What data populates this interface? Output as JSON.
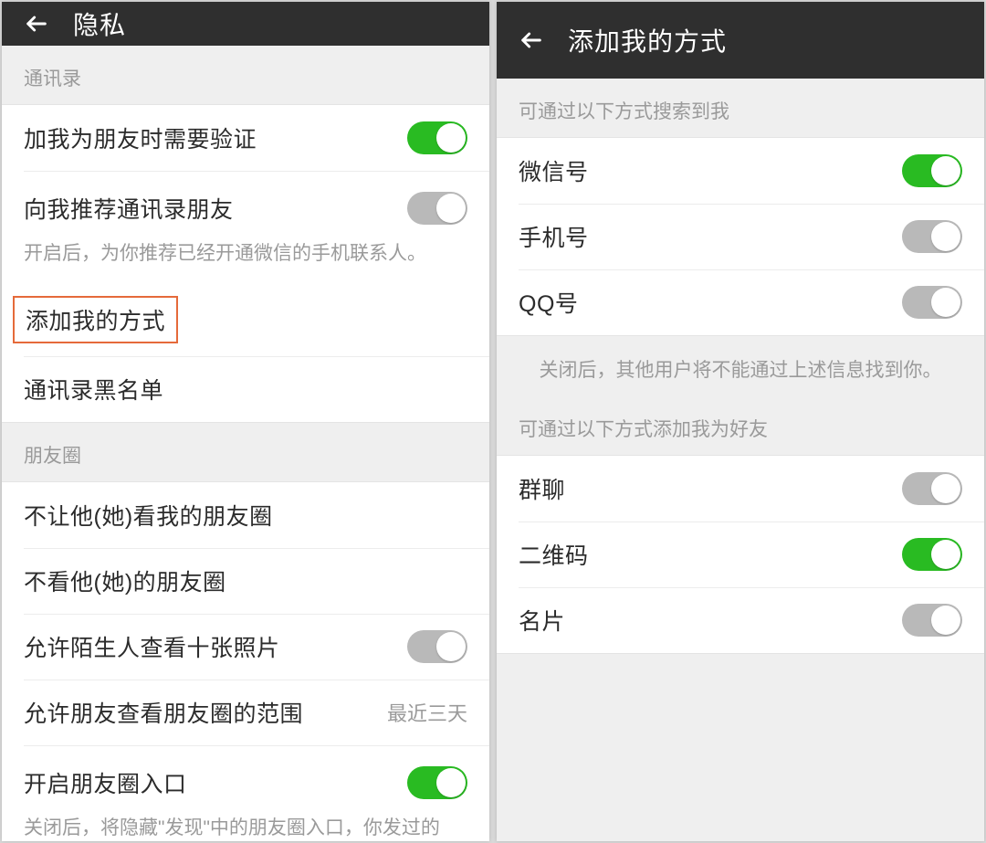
{
  "left": {
    "title": "隐私",
    "sections": {
      "contacts": {
        "header": "通讯录",
        "verify_label": "加我为朋友时需要验证",
        "verify_on": true,
        "recommend_label": "向我推荐通讯录朋友",
        "recommend_on": false,
        "recommend_hint": "开启后，为你推荐已经开通微信的手机联系人。",
        "add_methods_label": "添加我的方式",
        "blacklist_label": "通讯录黑名单"
      },
      "moments": {
        "header": "朋友圈",
        "hide_my_label": "不让他(她)看我的朋友圈",
        "hide_their_label": "不看他(她)的朋友圈",
        "stranger_label": "允许陌生人查看十张照片",
        "stranger_on": false,
        "range_label": "允许朋友查看朋友圈的范围",
        "range_value": "最近三天",
        "entry_label": "开启朋友圈入口",
        "entry_on": true,
        "entry_hint": "关闭后，将隐藏\"发现\"中的朋友圈入口，你发过的"
      }
    }
  },
  "right": {
    "title": "添加我的方式",
    "search_header": "可通过以下方式搜索到我",
    "search_items": {
      "wechat_id": {
        "label": "微信号",
        "on": true
      },
      "phone": {
        "label": "手机号",
        "on": false
      },
      "qq": {
        "label": "QQ号",
        "on": false
      }
    },
    "search_footer": "关闭后，其他用户将不能通过上述信息找到你。",
    "add_header": "可通过以下方式添加我为好友",
    "add_items": {
      "group": {
        "label": "群聊",
        "on": false
      },
      "qrcode": {
        "label": "二维码",
        "on": true
      },
      "card": {
        "label": "名片",
        "on": false
      }
    }
  }
}
